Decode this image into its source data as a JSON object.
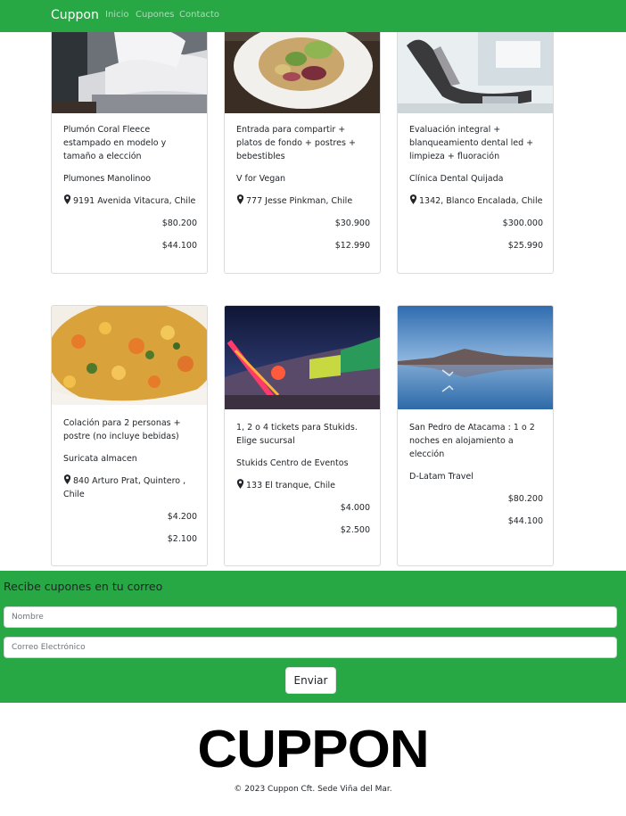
{
  "nav": {
    "brand": "Cuppon",
    "links": [
      "Inicio",
      "Cupones",
      "Contacto"
    ]
  },
  "cards": [
    {
      "title": "Plumón Coral Fleece estampado en modelo y tamaño a elección",
      "merchant": "Plumones Manolinoo",
      "address": "9191 Avenida Vitacura, Chile",
      "price": "$80.200",
      "price_discount": "$44.100",
      "image": "bedroom-photo"
    },
    {
      "title": "Entrada para compartir + platos de fondo + postres + bebestibles",
      "merchant": "V for Vegan",
      "address": "777 Jesse Pinkman, Chile",
      "price": "$30.900",
      "price_discount": "$12.990",
      "image": "salad-plate-photo"
    },
    {
      "title": "Evaluación integral + blanqueamiento dental led + limpieza + fluoración",
      "merchant": "Clínica Dental Quijada",
      "address": "1342, Blanco Encalada, Chile",
      "price": "$300.000",
      "price_discount": "$25.990",
      "image": "dental-chair-photo"
    },
    {
      "title": "Colación para 2 personas + postre (no incluye bebidas)",
      "merchant": "Suricata almacen",
      "address": "840 Arturo Prat, Quintero , Chile",
      "price": "$4.200",
      "price_discount": "$2.100",
      "image": "food-dish-photo"
    },
    {
      "title": "1, 2 o 4 tickets para Stukids. Elige sucursal",
      "merchant": "Stukids Centro de Eventos",
      "address": "133 El tranque, Chile",
      "price": "$4.000",
      "price_discount": "$2.500",
      "image": "fair-lights-photo"
    },
    {
      "title": "San Pedro de Atacama : 1 o 2 noches en alojamiento a elección",
      "merchant": "D-Latam Travel",
      "address": "",
      "price": "$80.200",
      "price_discount": "$44.100",
      "image": "lagoon-landscape-photo"
    }
  ],
  "newsletter": {
    "heading": "Recibe cupones en tu correo",
    "name_placeholder": "Nombre",
    "email_placeholder": "Correo Electrónico",
    "submit_label": "Enviar"
  },
  "footer": {
    "logo_text": "CUPPON",
    "copyright": "© 2023 Cuppon Cft. Sede Viña del Mar."
  },
  "colors": {
    "brand_green": "#28a745",
    "card_border": "#dddddd"
  }
}
